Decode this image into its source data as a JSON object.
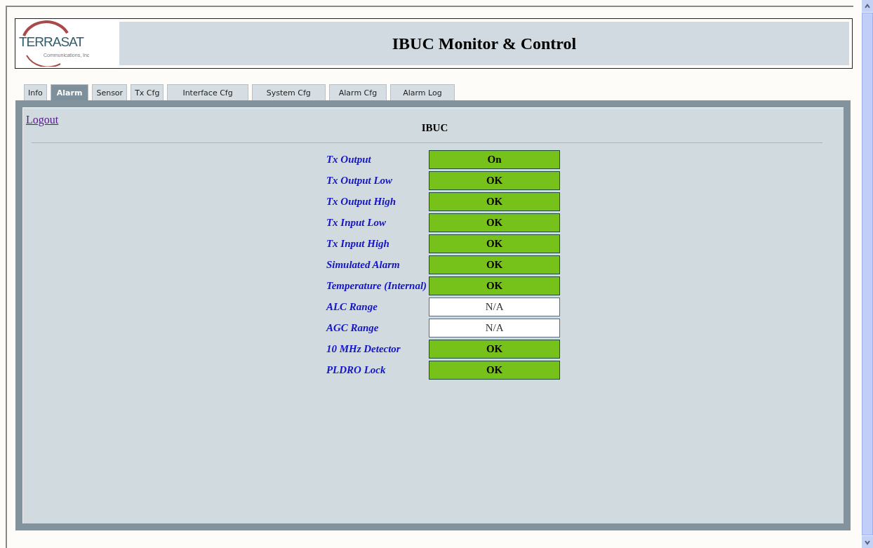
{
  "header": {
    "logo_name": "TERRASAT",
    "logo_tagline": "Communications, Inc",
    "title": "IBUC Monitor & Control"
  },
  "tabs": [
    {
      "label": "Info",
      "selected": false
    },
    {
      "label": "Alarm",
      "selected": true
    },
    {
      "label": "Sensor",
      "selected": false
    },
    {
      "label": "Tx Cfg",
      "selected": false
    },
    {
      "label": "Interface Cfg",
      "selected": false
    },
    {
      "label": "System Cfg",
      "selected": false
    },
    {
      "label": "Alarm Cfg",
      "selected": false
    },
    {
      "label": "Alarm Log",
      "selected": false
    }
  ],
  "logout": "Logout",
  "section_title": "IBUC",
  "alarms": [
    {
      "name": "Tx Output",
      "status": "On",
      "kind": "ok"
    },
    {
      "name": "Tx Output Low",
      "status": "OK",
      "kind": "ok"
    },
    {
      "name": "Tx Output High",
      "status": "OK",
      "kind": "ok"
    },
    {
      "name": "Tx Input Low",
      "status": "OK",
      "kind": "ok"
    },
    {
      "name": "Tx Input High",
      "status": "OK",
      "kind": "ok"
    },
    {
      "name": "Simulated Alarm",
      "status": "OK",
      "kind": "ok"
    },
    {
      "name": "Temperature (Internal)",
      "status": "OK",
      "kind": "ok"
    },
    {
      "name": "ALC Range",
      "status": "N/A",
      "kind": "na"
    },
    {
      "name": "AGC Range",
      "status": "N/A",
      "kind": "na"
    },
    {
      "name": "10 MHz Detector",
      "status": "OK",
      "kind": "ok"
    },
    {
      "name": "PLDRO Lock",
      "status": "OK",
      "kind": "ok"
    }
  ]
}
